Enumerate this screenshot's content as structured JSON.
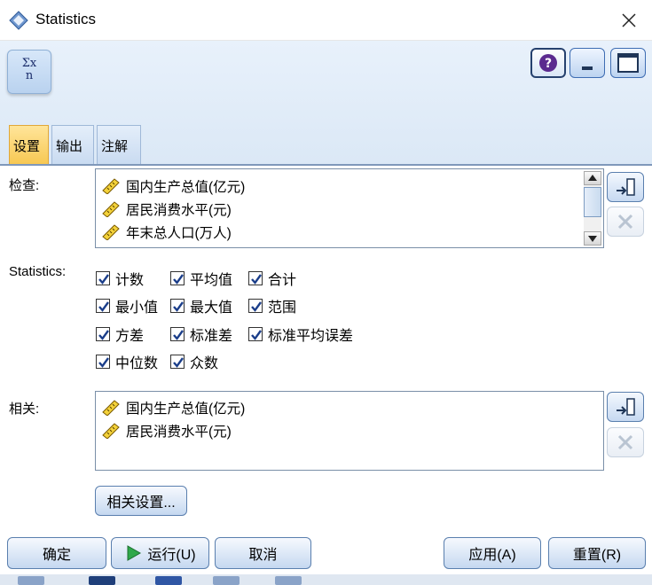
{
  "window": {
    "title": "Statistics"
  },
  "tabs": [
    {
      "label": "设置",
      "active": true
    },
    {
      "label": "输出",
      "active": false
    },
    {
      "label": "注解",
      "active": false
    }
  ],
  "examine": {
    "label": "检查:",
    "items": [
      "国内生产总值(亿元)",
      "居民消费水平(元)",
      "年末总人口(万人)"
    ]
  },
  "statistics": {
    "label": "Statistics:",
    "options": [
      {
        "label": "计数",
        "checked": true
      },
      {
        "label": "平均值",
        "checked": true
      },
      {
        "label": "合计",
        "checked": true
      },
      {
        "label": "最小值",
        "checked": true
      },
      {
        "label": "最大值",
        "checked": true
      },
      {
        "label": "范围",
        "checked": true
      },
      {
        "label": "方差",
        "checked": true
      },
      {
        "label": "标准差",
        "checked": true
      },
      {
        "label": "标准平均误差",
        "checked": true
      },
      {
        "label": "中位数",
        "checked": true
      },
      {
        "label": "众数",
        "checked": true
      }
    ]
  },
  "correlate": {
    "label": "相关:",
    "items": [
      "国内生产总值(亿元)",
      "居民消费水平(元)"
    ],
    "settings_button": "相关设置..."
  },
  "footer": {
    "ok": "确定",
    "run": "运行(U)",
    "cancel": "取消",
    "apply": "应用(A)",
    "reset": "重置(R)"
  },
  "icons": {
    "app": "diamond-app-icon",
    "node": "sigma-statistics-icon",
    "field": "ruler-field-icon",
    "accent": "#4a78b5"
  }
}
